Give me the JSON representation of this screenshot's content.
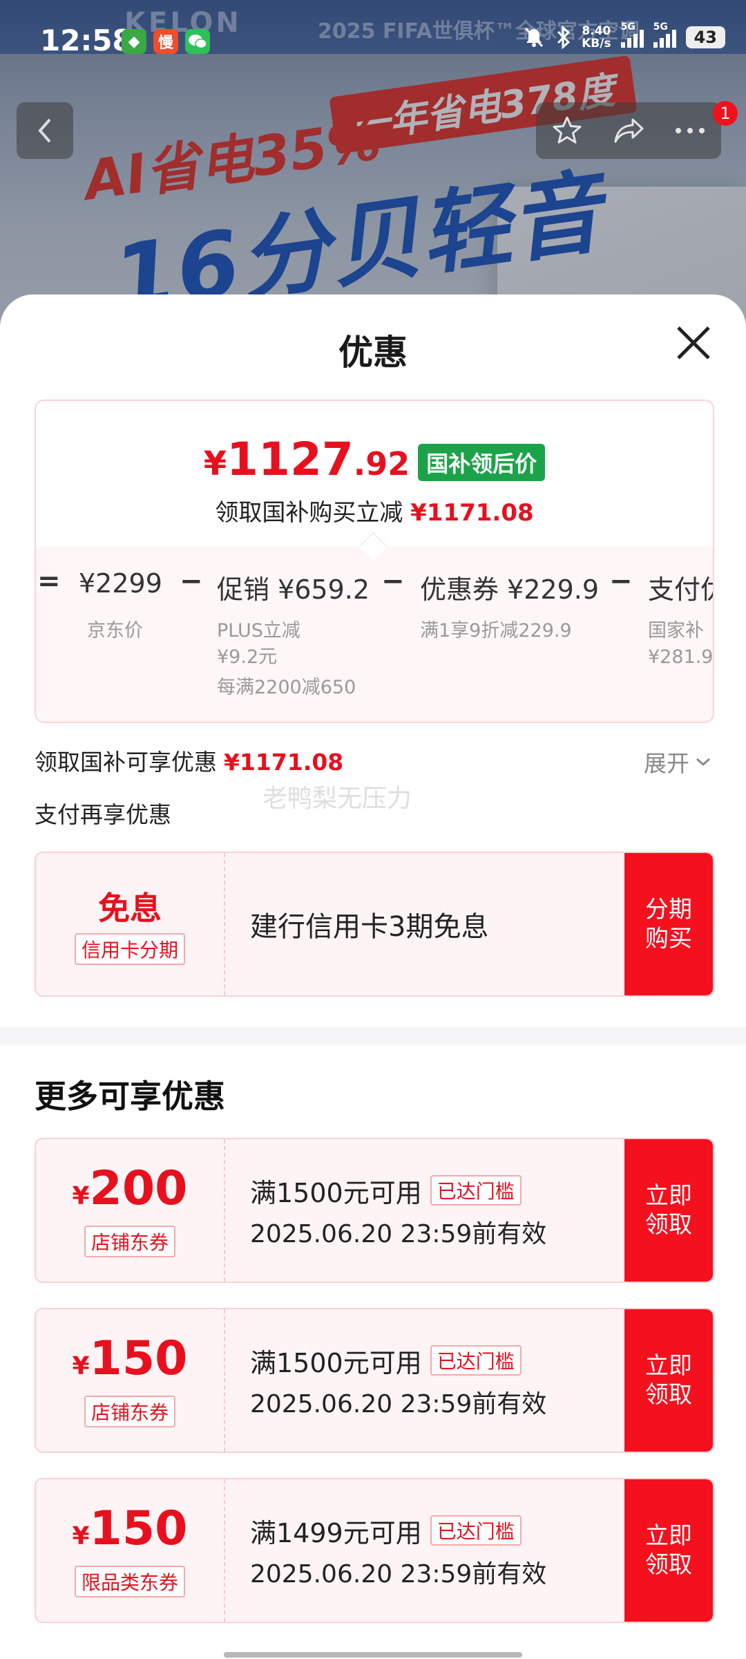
{
  "status_bar": {
    "time": "12:58",
    "net_speed": "8.40",
    "net_unit": "KB/s",
    "signal1": "5G",
    "signal2": "5G",
    "battery": "43"
  },
  "banner": {
    "brand": "KELON",
    "brand_sub": "2025 FIFA世俱杯™全球官方空调",
    "ad_tag": "一年省电378度",
    "ad_line1": "AI省电35%",
    "ad_line2": "16分贝轻音"
  },
  "nav": {
    "notification_count": "1"
  },
  "sheet": {
    "title": "优惠",
    "price": {
      "yen": "¥",
      "integer": "1127",
      "decimal": ".92",
      "badge": "国补领后价",
      "sub_text": "领取国补购买立减",
      "sub_amount": "¥1171.08"
    },
    "calc": {
      "eq": "=",
      "base_price": "¥2299",
      "base_label": "京东价",
      "minus1": "−",
      "promo": "促销 ¥659.2",
      "promo_detail1": "PLUS立减",
      "promo_detail2": "¥9.2元",
      "promo_detail3": "每满2200减650",
      "minus2": "−",
      "coupon": "优惠券 ¥229.9",
      "coupon_detail": "满1享9折减229.9",
      "minus3": "−",
      "pay": "支付优",
      "pay_detail1": "国家补",
      "pay_detail2": "¥281.9"
    },
    "subsidy_text": "领取国补可享优惠",
    "subsidy_amount": "¥1171.08",
    "expand_label": "展开",
    "pay_more_label": "支付再享优惠",
    "watermark": "老鸭梨无压力",
    "installment": {
      "title": "免息",
      "tag": "信用卡分期",
      "desc": "建行信用卡3期免息",
      "action": "分期购买"
    },
    "more_title": "更多可享优惠",
    "coupons": [
      {
        "yen": "¥",
        "amount": "200",
        "tag": "店铺东券",
        "condition": "满1500元可用",
        "reached": "已达门槛",
        "valid": "2025.06.20 23:59前有效",
        "action": "立即领取"
      },
      {
        "yen": "¥",
        "amount": "150",
        "tag": "店铺东券",
        "condition": "满1500元可用",
        "reached": "已达门槛",
        "valid": "2025.06.20 23:59前有效",
        "action": "立即领取"
      },
      {
        "yen": "¥",
        "amount": "150",
        "tag": "限品类东券",
        "condition": "满1499元可用",
        "reached": "已达门槛",
        "valid": "2025.06.20 23:59前有效",
        "action": "立即领取"
      }
    ]
  },
  "colors": {
    "accent_red": "#e8101e",
    "button_red": "#f5101e",
    "badge_green": "#1ca34a"
  }
}
